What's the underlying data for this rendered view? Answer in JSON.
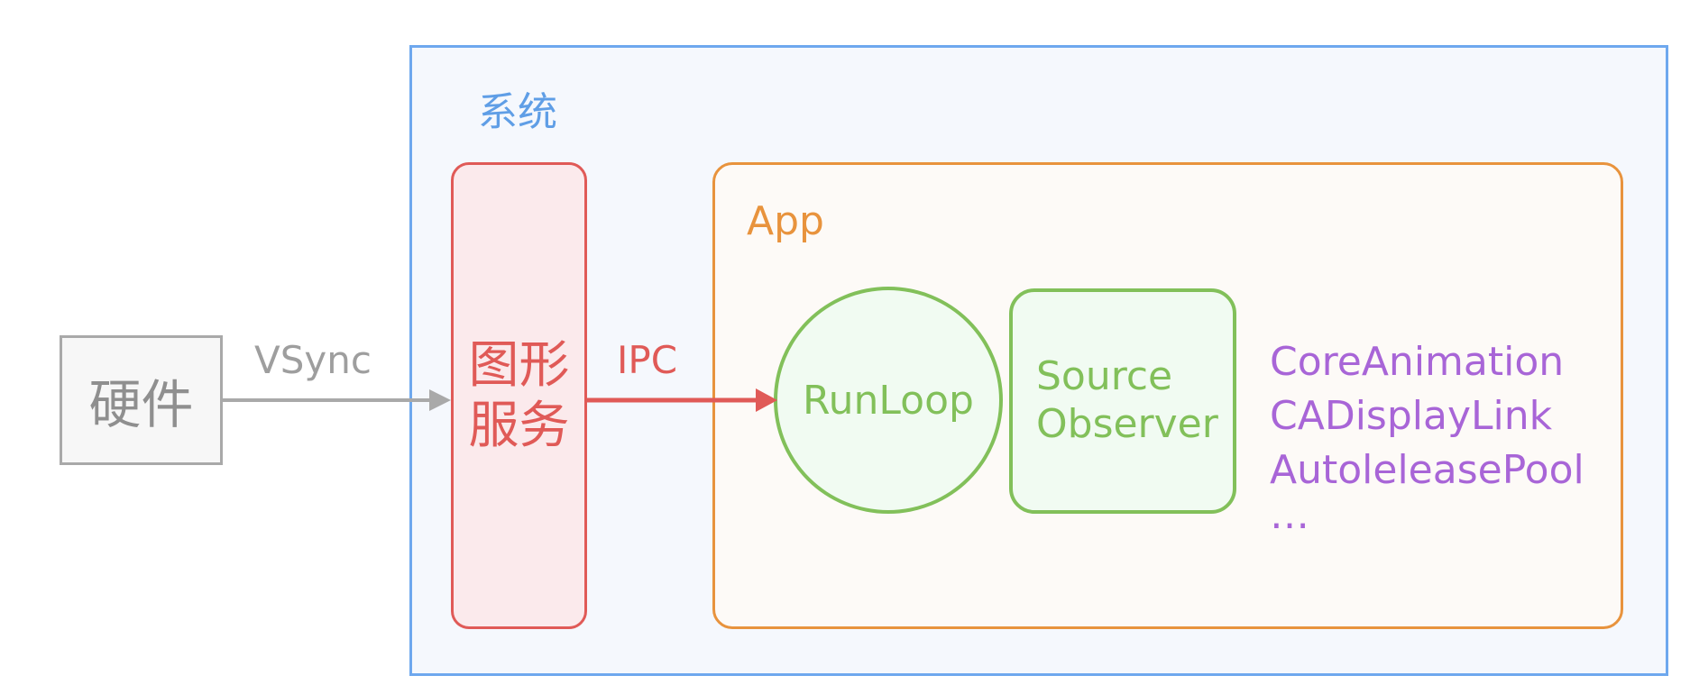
{
  "system": {
    "label": "系统"
  },
  "hardware": {
    "label": "硬件"
  },
  "edges": {
    "vsync": "VSync",
    "ipc": "IPC"
  },
  "graphics_service": {
    "label": "图形服务"
  },
  "app": {
    "label": "App"
  },
  "runloop": {
    "label": "RunLoop"
  },
  "source_observer": {
    "line1": "Source",
    "line2": "Observer"
  },
  "components": {
    "items": [
      "CoreAnimation",
      "CADisplayLink",
      "AutoleleasePool"
    ],
    "more": "…"
  },
  "colors": {
    "system": "#6ea8ee",
    "hardware": "#a9a9a9",
    "graphics": "#e05a57",
    "app": "#e8933d",
    "runloop": "#82c05a",
    "components": "#a865d7"
  }
}
